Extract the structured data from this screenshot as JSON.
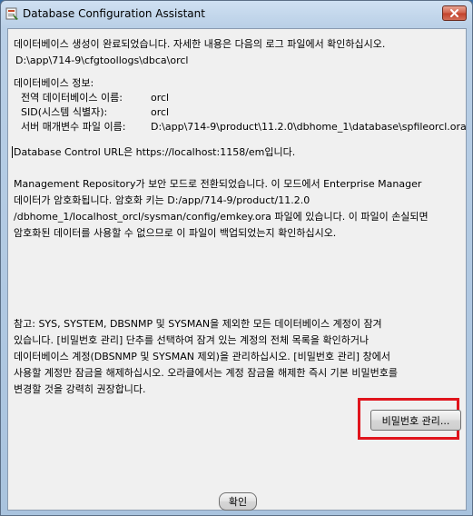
{
  "window": {
    "title": "Database Configuration Assistant",
    "app_icon": "dbca-app-icon",
    "close_icon": "close-icon"
  },
  "message": {
    "completion_line": "데이터베이스 생성이 완료되었습니다. 자세한 내용은 다음의 로그 파일에서 확인하십시오.",
    "log_path": "D:\\app\\714-9\\cfgtoollogs\\dbca\\orcl",
    "db_info_heading": "데이터베이스 정보:",
    "global_db_label": "전역 데이터베이스 이름:",
    "global_db_value": "orcl",
    "sid_label": "SID(시스템 식별자):",
    "sid_value": "orcl",
    "spfile_label": "서버 매개변수 파일 이름:",
    "spfile_value": "D:\\app\\714-9\\product\\11.2.0\\dbhome_1\\database\\spfileorcl.ora",
    "dbcontrol_line": "Database Control URL은 https://localhost:1158/em입니다.",
    "repo_line1": "Management Repository가 보안 모드로 전환되었습니다. 이 모드에서 Enterprise Manager",
    "repo_line2": "데이터가 암호화됩니다. 암호화 키는 D:/app/714-9/product/11.2.0",
    "repo_line3": "/dbhome_1/localhost_orcl/sysman/config/emkey.ora 파일에 있습니다. 이 파일이 손실되면",
    "repo_line4": "암호화된 데이터를 사용할 수 없으므로 이 파일이 백업되었는지 확인하십시오.",
    "note_line1": "참고: SYS, SYSTEM, DBSNMP 및 SYSMAN을 제외한 모든 데이터베이스 계정이 잠겨",
    "note_line2": "있습니다. [비밀번호 관리] 단추를 선택하여 잠겨 있는 계정의 전체 목록을 확인하거나",
    "note_line3": "데이터베이스 계정(DBSNMP 및 SYSMAN 제외)을 관리하십시오. [비밀번호 관리] 창에서",
    "note_line4": "사용할 계정만 잠금을 해제하십시오. 오라클에서는 계정 잠금을 해제한 즉시 기본 비밀번호를",
    "note_line5": "변경할 것을 강력히 권장합니다."
  },
  "buttons": {
    "password_mgmt_label": "비밀번호 관리...",
    "ok_label": "확인"
  },
  "colors": {
    "highlight": "#e0141c",
    "client_bg": "#f0f0f0"
  }
}
